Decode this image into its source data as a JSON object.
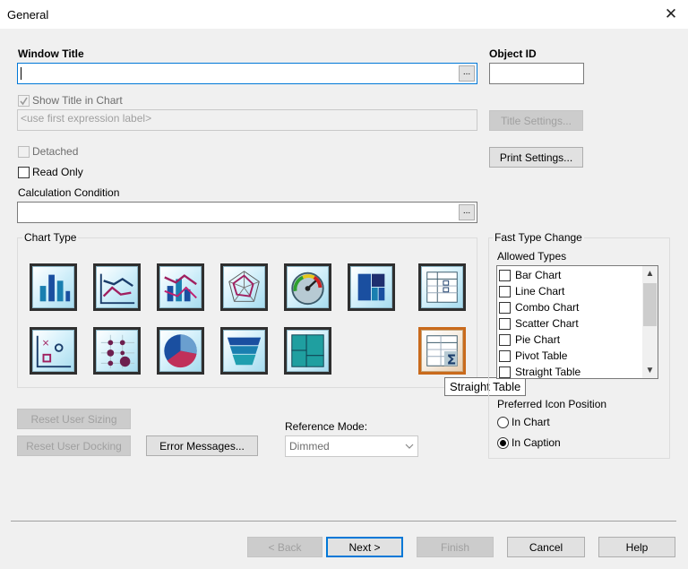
{
  "dialog": {
    "title": "General"
  },
  "window_title": {
    "label": "Window Title",
    "value": "",
    "ellipsis": "..."
  },
  "object_id": {
    "label": "Object ID",
    "value": ""
  },
  "show_title": {
    "label": "Show Title in Chart",
    "checked": true,
    "disabled": true,
    "placeholder": "<use first expression label>"
  },
  "title_settings_label": "Title Settings...",
  "print_settings_label": "Print Settings...",
  "detached": {
    "label": "Detached",
    "checked": false,
    "disabled": true
  },
  "read_only": {
    "label": "Read Only",
    "checked": false
  },
  "calc_condition": {
    "label": "Calculation Condition",
    "value": "",
    "ellipsis": "..."
  },
  "chart_type": {
    "label": "Chart Type",
    "icons": [
      {
        "name": "bar-chart-icon"
      },
      {
        "name": "line-chart-icon"
      },
      {
        "name": "combo-chart-icon"
      },
      {
        "name": "radar-chart-icon"
      },
      {
        "name": "gauge-chart-icon"
      },
      {
        "name": "block-chart-icon"
      },
      {
        "name": "pivot-table-icon"
      },
      {
        "name": "scatter-chart-icon"
      },
      {
        "name": "grid-chart-icon"
      },
      {
        "name": "pie-chart-icon"
      },
      {
        "name": "funnel-chart-icon"
      },
      {
        "name": "mekko-chart-icon"
      },
      {
        "name": "straight-table-icon",
        "selected": true
      }
    ],
    "tooltip": "Straight Table"
  },
  "fast_type_change": {
    "label": "Fast Type Change",
    "allowed_types_label": "Allowed Types",
    "items": [
      {
        "label": "Bar Chart",
        "checked": false
      },
      {
        "label": "Line Chart",
        "checked": false
      },
      {
        "label": "Combo Chart",
        "checked": false
      },
      {
        "label": "Scatter Chart",
        "checked": false
      },
      {
        "label": "Pie Chart",
        "checked": false
      },
      {
        "label": "Pivot Table",
        "checked": false
      },
      {
        "label": "Straight Table",
        "checked": false
      }
    ],
    "preferred_icon_position_label": "Preferred Icon Position",
    "position_options": [
      {
        "label": "In Chart",
        "selected": false
      },
      {
        "label": "In Caption",
        "selected": true
      }
    ]
  },
  "reset_user_sizing_label": "Reset User Sizing",
  "reset_user_docking_label": "Reset User Docking",
  "error_messages_label": "Error Messages...",
  "reference_mode": {
    "label": "Reference Mode:",
    "value": "Dimmed"
  },
  "footer": {
    "back_label": "< Back",
    "next_label": "Next >",
    "finish_label": "Finish",
    "cancel_label": "Cancel",
    "help_label": "Help"
  },
  "colors": {
    "accent": "#0078d7",
    "selected_icon_border": "#c96a1c",
    "dialog_bg": "#f0f0f0"
  }
}
